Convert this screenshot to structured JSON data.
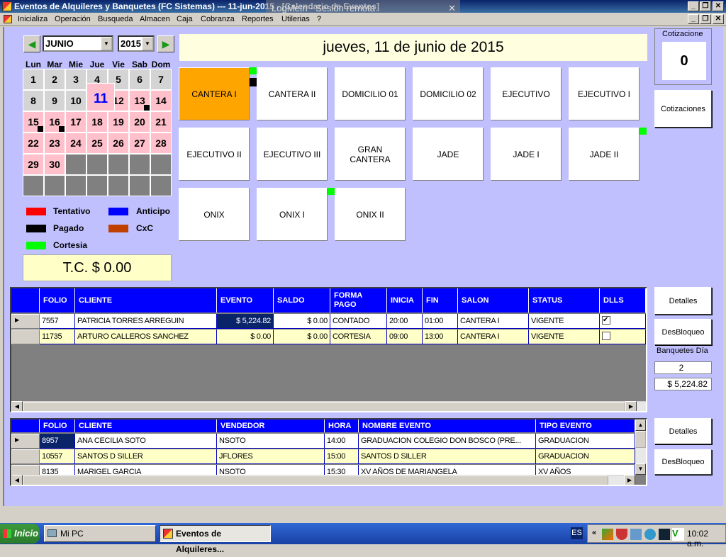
{
  "window": {
    "title": "Eventos de Alquileres y Banquetes  (FC Sistemas)     --- 11-jun-2015 - [Calendario de Eventos]",
    "overlay": "LogMeIn - Sesión remota"
  },
  "menu": [
    "Inicializa",
    "Operación",
    "Busqueda",
    "Almacen",
    "Caja",
    "Cobranza",
    "Reportes",
    "Utilerias",
    "?"
  ],
  "calendar": {
    "month": "JUNIO",
    "year": "2015",
    "weekdays": [
      "Lun",
      "Mar",
      "Mie",
      "Jue",
      "Vie",
      "Sab",
      "Dom"
    ],
    "days": 30,
    "selected_day": 11,
    "first_weekday_index": 0,
    "booked_days": [
      11,
      12,
      13,
      14,
      15,
      16,
      17,
      18,
      19,
      20,
      21,
      22,
      23,
      24,
      25,
      26,
      27,
      28,
      29,
      30
    ],
    "marked_days": [
      11,
      13,
      15,
      16
    ],
    "colors": {
      "free": "#d4d4d4",
      "booked": "#ffc0cb",
      "empty": "#808080",
      "selected_text": "#0000ff"
    }
  },
  "legend": [
    {
      "label": "Tentativo",
      "color": "#ff0000"
    },
    {
      "label": "Anticipo",
      "color": "#0000ff"
    },
    {
      "label": "Pagado",
      "color": "#000000"
    },
    {
      "label": "CxC",
      "color": "#c04000"
    },
    {
      "label": "Cortesia",
      "color": "#00ff00"
    }
  ],
  "exchange_rate": "T.C. $ 0.00",
  "date_banner": "jueves, 11 de junio de 2015",
  "salons": [
    {
      "name": "CANTERA I",
      "selected": true,
      "indicators": [
        "#00ff00",
        "#000000"
      ]
    },
    {
      "name": "CANTERA II"
    },
    {
      "name": "DOMICILIO 01"
    },
    {
      "name": "DOMICILIO 02"
    },
    {
      "name": "EJECUTIVO"
    },
    {
      "name": "EJECUTIVO I"
    },
    {
      "name": "EJECUTIVO II"
    },
    {
      "name": "EJECUTIVO III"
    },
    {
      "name": "GRAN\nCANTERA"
    },
    {
      "name": "JADE"
    },
    {
      "name": "JADE I"
    },
    {
      "name": "JADE II",
      "indicators": [
        "#00ff00"
      ]
    },
    {
      "name": "ONIX"
    },
    {
      "name": "ONIX I",
      "indicators": [
        "#00ff00"
      ]
    },
    {
      "name": "ONIX II"
    }
  ],
  "cotizacion": {
    "label": "Cotizacione",
    "value": "0",
    "button": "Cotizaciones"
  },
  "events_grid": {
    "columns": [
      "FOLIO",
      "CLIENTE",
      "EVENTO",
      "SALDO",
      "FORMA\nPAGO",
      "INICIA",
      "FIN",
      "SALON",
      "STATUS",
      "DLLS"
    ],
    "rows": [
      [
        "7557",
        "PATRICIA TORRES ARREGUIN",
        "$ 5,224.82",
        "$ 0.00",
        "CONTADO",
        "20:00",
        "01:00",
        "CANTERA I",
        "VIGENTE",
        true
      ],
      [
        "11735",
        "ARTURO CALLEROS SANCHEZ",
        "$ 0.00",
        "$ 0.00",
        "CORTESIA",
        "09:00",
        "13:00",
        "CANTERA I",
        "VIGENTE",
        false
      ]
    ]
  },
  "side1": {
    "details": "Detalles",
    "unlock": "DesBloqueo",
    "banquets_label": "Banquetes Día",
    "banquets_count": "2",
    "banquets_total": "$ 5,224.82"
  },
  "quotes_grid": {
    "columns": [
      "FOLIO",
      "CLIENTE",
      "VENDEDOR",
      "HORA",
      "NOMBRE EVENTO",
      "TIPO EVENTO"
    ],
    "rows": [
      [
        "8957",
        "ANA CECILIA SOTO",
        "NSOTO",
        "14:00",
        "GRADUACION  COLEGIO  DON  BOSCO (PRE...",
        "GRADUACION"
      ],
      [
        "10557",
        "SANTOS D SILLER",
        "JFLORES",
        "15:00",
        "SANTOS D SILLER",
        "GRADUACION"
      ],
      [
        "8135",
        "MARIGEL GARCIA",
        "NSOTO",
        "15:30",
        "XV AÑOS DE MARIANGELA",
        "XV AÑOS"
      ]
    ]
  },
  "side2": {
    "details": "Detalles",
    "unlock": "DesBloqueo"
  },
  "taskbar": {
    "start": "Inicio",
    "tasks": [
      "Mi PC",
      "Eventos de Alquileres..."
    ],
    "lang": "ES",
    "clock": "10:02 a.m."
  }
}
